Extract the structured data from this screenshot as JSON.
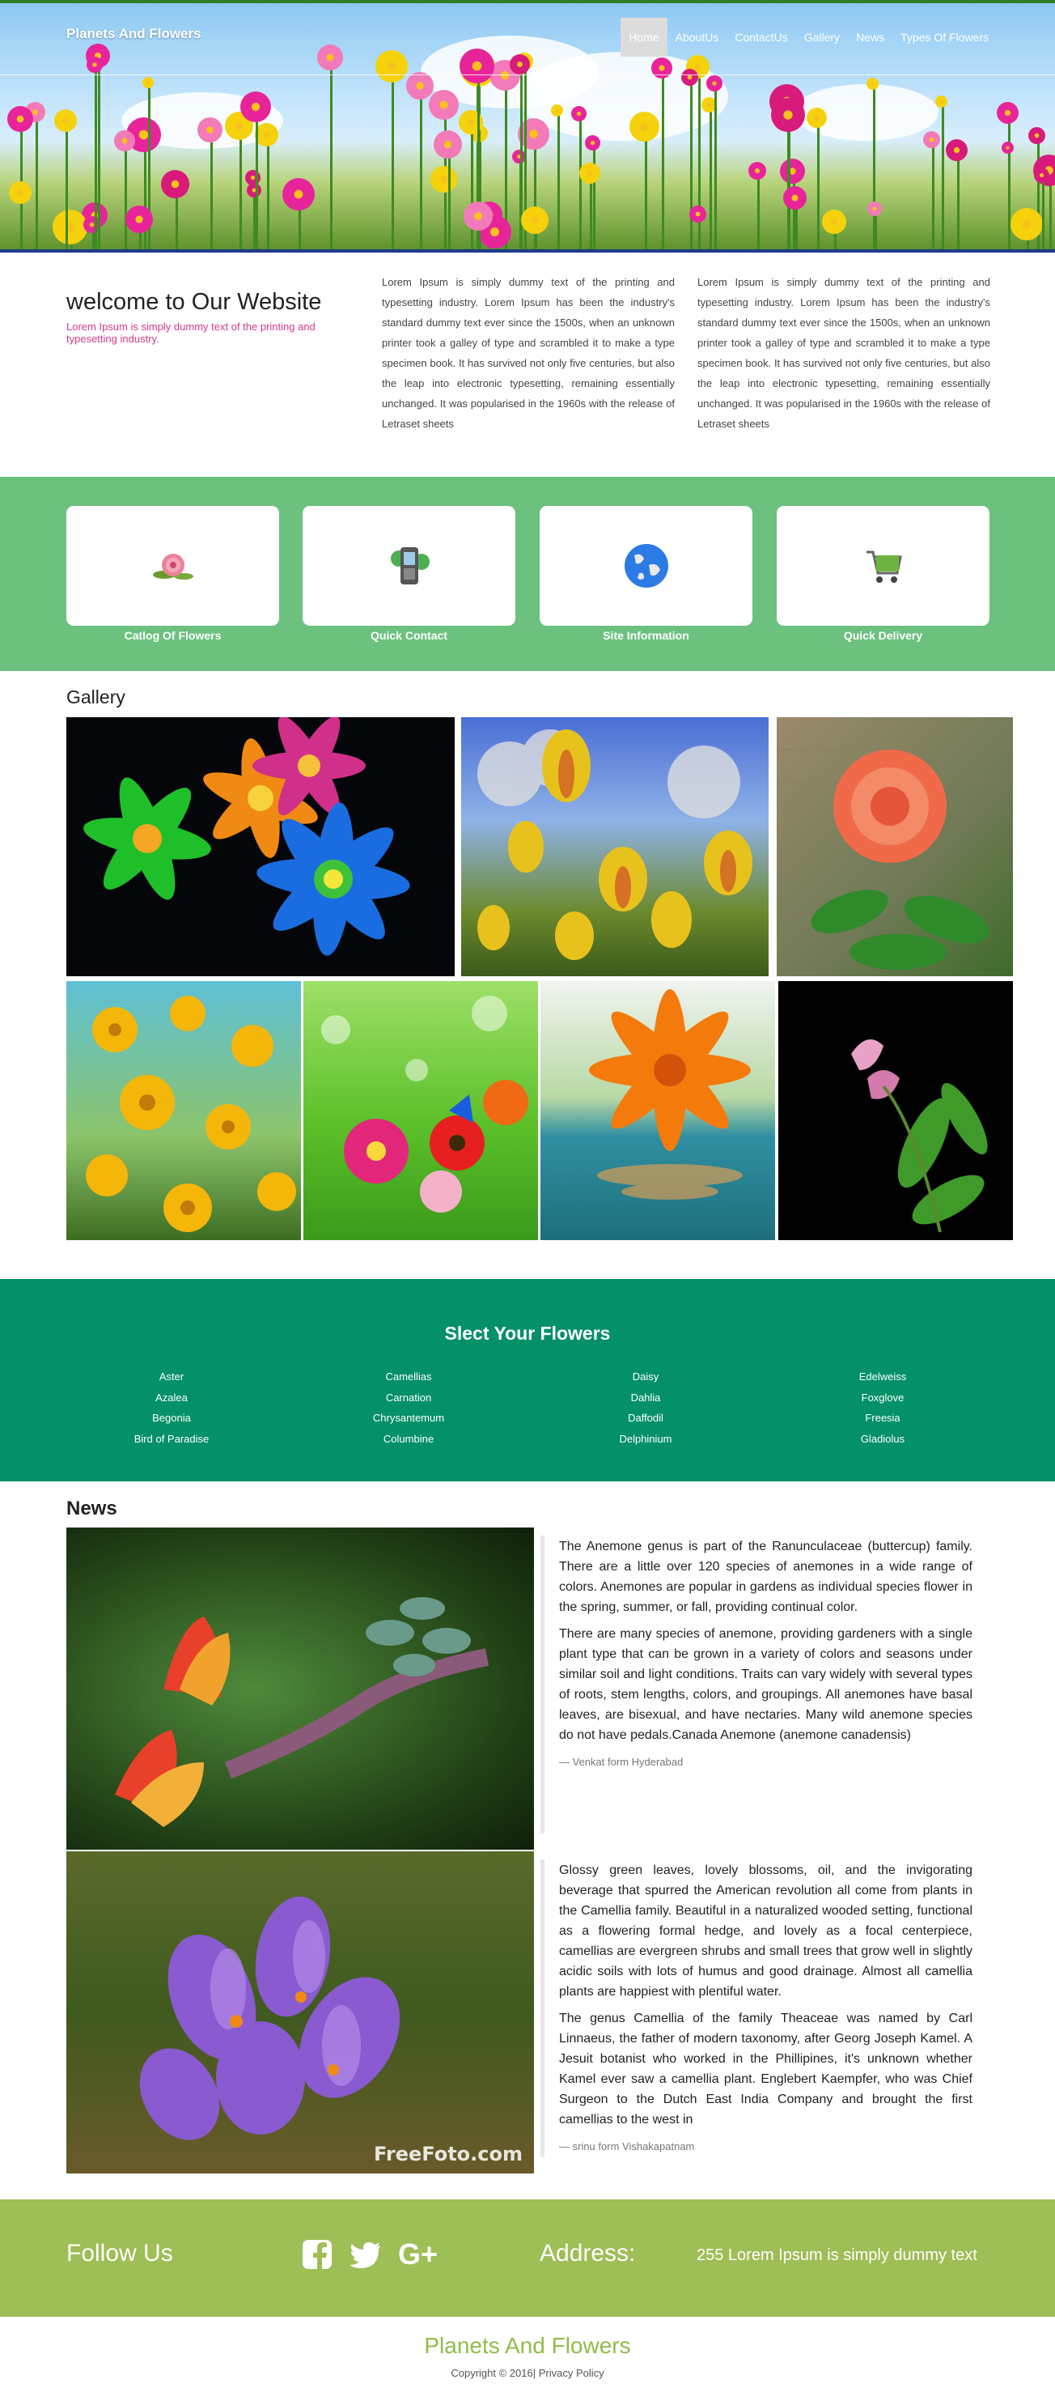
{
  "header": {
    "brand": "Planets And Flowers",
    "nav": [
      "Home",
      "AboutUs",
      "ContactUs",
      "Gallery",
      "News",
      "Types Of Flowers"
    ]
  },
  "welcome": {
    "title": "welcome to Our Website",
    "subtitle": "Lorem Ipsum is simply dummy text of the printing and typesetting industry.",
    "col1": "Lorem Ipsum is simply dummy text of the printing and typesetting industry. Lorem Ipsum has been the industry's standard dummy text ever since the 1500s, when an unknown printer took a galley of type and scrambled it to make a type specimen book. It has survived not only five centuries, but also the leap into electronic typesetting, remaining essentially unchanged. It was popularised in the 1960s with the release of Letraset sheets",
    "col2": "Lorem Ipsum is simply dummy text of the printing and typesetting industry. Lorem Ipsum has been the industry's standard dummy text ever since the 1500s, when an unknown printer took a galley of type and scrambled it to make a type specimen book. It has survived not only five centuries, but also the leap into electronic typesetting, remaining essentially unchanged. It was popularised in the 1960s with the release of Letraset sheets"
  },
  "features": [
    {
      "label": "Catlog Of Flowers",
      "icon": "flower-icon"
    },
    {
      "label": "Quick Contact",
      "icon": "phone-icon"
    },
    {
      "label": "Site Information",
      "icon": "globe-icon"
    },
    {
      "label": "Quick Delivery",
      "icon": "cart-icon"
    }
  ],
  "gallery": {
    "title": "Gallery"
  },
  "select": {
    "title": "Slect Your Flowers",
    "columns": [
      [
        "Aster",
        "Azalea",
        "Begonia",
        "Bird of Paradise"
      ],
      [
        "Camellias",
        "Carnation",
        "Chrysantemum",
        "Columbine"
      ],
      [
        "Daisy",
        "Dahlia",
        "Daffodil",
        "Delphinium"
      ],
      [
        "Edelweiss",
        "Foxglove",
        "Freesia",
        "Gladiolus"
      ]
    ]
  },
  "news": {
    "title": "News",
    "items": [
      {
        "p1": "The Anemone genus is part of the Ranunculaceae (buttercup) family. There are a little over 120 species of anemones in a wide range of colors. Anemones are popular in gardens as individual species flower in the spring, summer, or fall, providing continual color.",
        "p2": "There are many species of anemone, providing gardeners with a single plant type that can be grown in a variety of colors and seasons under similar soil and light conditions. Traits can vary widely with several types of roots, stem lengths, colors, and groupings. All anemones have basal leaves, are bisexual, and have nectaries. Many wild anemone species do not have pedals.Canada Anemone (anemone canadensis)",
        "cite": "— Venkat form Hyderabad"
      },
      {
        "p1": "Glossy green leaves, lovely blossoms, oil, and the invigorating beverage that spurred the American revolution all come from plants in the Camellia family. Beautiful in a naturalized wooded setting, functional as a flowering formal hedge, and lovely as a focal centerpiece, camellias are evergreen shrubs and small trees that grow well in slightly acidic soils with lots of humus and good drainage. Almost all camellia plants are happiest with plentiful water.",
        "p2": "The genus Camellia of the family Theaceae was named by Carl Linnaeus, the father of modern taxonomy, after Georg Joseph Kamel. A Jesuit botanist who worked in the Phillipines, it's unknown whether Kamel ever saw a camellia plant. Englebert Kaempfer, who was Chief Surgeon to the Dutch East India Company and brought the first camellias to the west in",
        "cite": "— srinu form Vishakapatnam",
        "watermark": "FreeFoto.com"
      }
    ]
  },
  "follow": {
    "label": "Follow Us",
    "icons": [
      "facebook-icon",
      "twitter-icon",
      "google-plus-icon"
    ],
    "address_label": "Address:",
    "address": "255 Lorem Ipsum is simply dummy text"
  },
  "footer": {
    "title": "Planets And Flowers",
    "copyright": "Copyright © 2016| Privacy Policy"
  }
}
